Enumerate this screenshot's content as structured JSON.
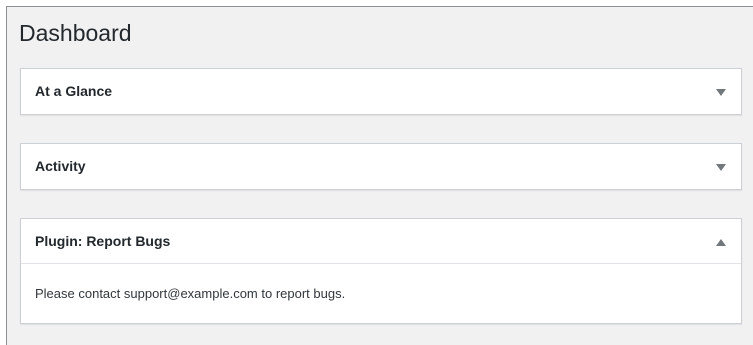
{
  "page": {
    "title": "Dashboard"
  },
  "widgets": [
    {
      "title": "At a Glance",
      "state": "collapsed",
      "toggle_icon": "triangle-down-icon"
    },
    {
      "title": "Activity",
      "state": "collapsed",
      "toggle_icon": "triangle-down-icon"
    },
    {
      "title": "Plugin: Report Bugs",
      "state": "expanded",
      "toggle_icon": "triangle-up-icon",
      "content": "Please contact support@example.com to report bugs."
    }
  ],
  "colors": {
    "background": "#f1f1f1",
    "panel": "#ffffff",
    "panel_border": "#ccd0d4",
    "text": "#23282d",
    "icon": "#72777c"
  }
}
